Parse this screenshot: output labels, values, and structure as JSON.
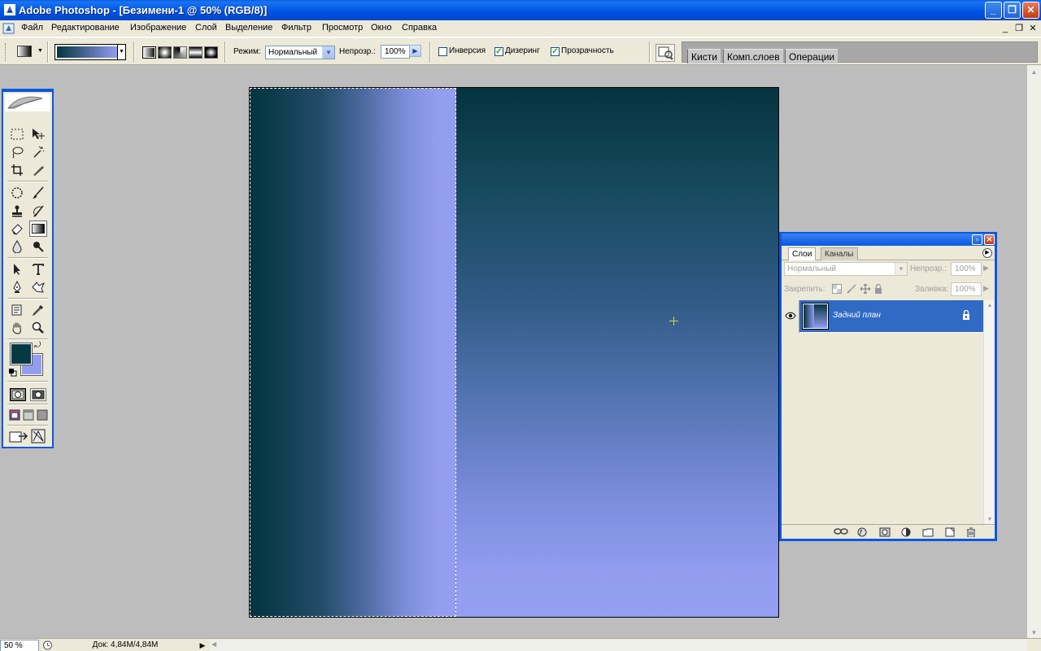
{
  "window": {
    "title": "Adobe Photoshop - [Безимени-1 @ 50% (RGB/8)]",
    "buttons": {
      "minimize": "_",
      "maximize": "❐",
      "close": "✕"
    }
  },
  "menu": {
    "items": [
      "Файл",
      "Редактирование",
      "Изображение",
      "Слой",
      "Выделение",
      "Фильтр",
      "Просмотр",
      "Окно",
      "Справка"
    ],
    "doc_buttons": {
      "minimize": "_",
      "restore": "❐",
      "close": "✕"
    }
  },
  "options": {
    "mode_label": "Режим:",
    "mode_value": "Нормальный",
    "opacity_label": "Непрозр.:",
    "opacity_value": "100%",
    "checkboxes": [
      {
        "label": "Инверсия",
        "checked": false
      },
      {
        "label": "Дизеринг",
        "checked": true
      },
      {
        "label": "Прозрачность",
        "checked": true
      }
    ],
    "gradient_types": [
      "linear",
      "radial",
      "angle",
      "reflected",
      "diamond"
    ],
    "selected_gradient_type": "linear",
    "well_tabs": [
      "Кисти",
      "Комп.слоев",
      "Операции"
    ]
  },
  "colors": {
    "foreground": "#053a45",
    "background": "#929df0",
    "accent": "#0a58e0",
    "selection": "#316ac5"
  },
  "toolbox": {
    "selected_tool": "gradient-tool",
    "tools": [
      "marquee-tool",
      "move-tool",
      "lasso-tool",
      "magic-wand-tool",
      "crop-tool",
      "slice-tool",
      "healing-brush-tool",
      "brush-tool",
      "clone-stamp-tool",
      "history-brush-tool",
      "eraser-tool",
      "gradient-tool",
      "blur-tool",
      "dodge-tool",
      "path-selection-tool",
      "type-tool",
      "pen-tool",
      "shape-tool",
      "notes-tool",
      "eyedropper-tool",
      "hand-tool",
      "zoom-tool"
    ]
  },
  "layers_panel": {
    "tabs": [
      "Слои",
      "Каналы"
    ],
    "active_tab": "Слои",
    "blend_mode": "Нормальный",
    "opacity_label": "Непрозр.:",
    "opacity_value": "100%",
    "lock_label": "Закрепить:",
    "fill_label": "Заливка:",
    "fill_value": "100%",
    "layers": [
      {
        "name": "Задний план",
        "visible": true,
        "locked": true,
        "selected": true
      }
    ]
  },
  "status": {
    "zoom": "50 %",
    "doc_info": "Док: 4,84M/4,84M"
  }
}
